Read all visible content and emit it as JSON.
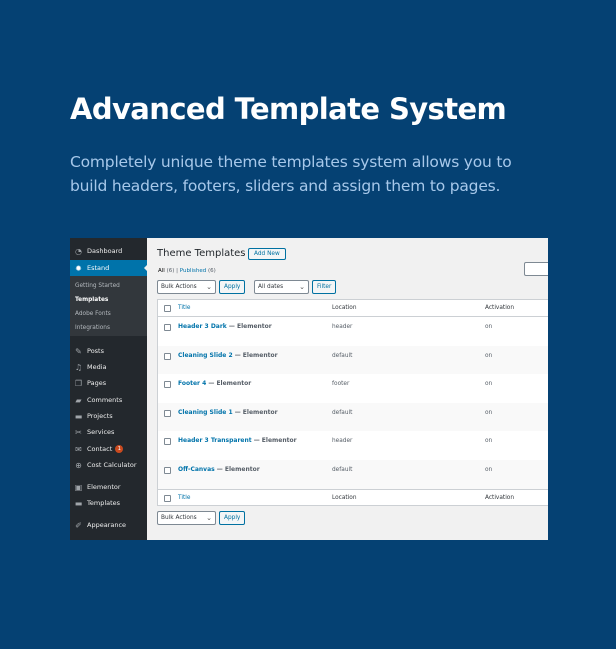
{
  "hero": {
    "title": "Advanced Template System",
    "subtitle": "Completely unique theme templates system allows you to build headers, footers, sliders and assign them to pages."
  },
  "sidebar": {
    "items": [
      {
        "label": "Dashboard",
        "icon": "dashboard-icon"
      },
      {
        "label": "Estand",
        "icon": "gear-icon",
        "active": true
      },
      {
        "label": "Posts",
        "icon": "pin-icon"
      },
      {
        "label": "Media",
        "icon": "media-icon"
      },
      {
        "label": "Pages",
        "icon": "pages-icon"
      },
      {
        "label": "Comments",
        "icon": "comment-icon"
      },
      {
        "label": "Projects",
        "icon": "folder-icon"
      },
      {
        "label": "Services",
        "icon": "tools-icon"
      },
      {
        "label": "Contact",
        "icon": "mail-icon",
        "badge": "1"
      },
      {
        "label": "Cost Calculator",
        "icon": "plus-circle-icon"
      },
      {
        "label": "Elementor",
        "icon": "elementor-icon"
      },
      {
        "label": "Templates",
        "icon": "folder-icon"
      },
      {
        "label": "Appearance",
        "icon": "brush-icon"
      }
    ],
    "submenu": [
      {
        "label": "Getting Started"
      },
      {
        "label": "Templates",
        "current": true
      },
      {
        "label": "Adobe Fonts"
      },
      {
        "label": "Integrations"
      }
    ]
  },
  "main": {
    "page_title": "Theme Templates",
    "add_new_label": "Add New",
    "views": {
      "all": "All",
      "all_count": "(6)",
      "separator": "|",
      "published": "Published",
      "published_count": "(6)"
    },
    "bulk_actions": "Bulk Actions",
    "apply_label": "Apply",
    "all_dates": "All dates",
    "filter_label": "Filter",
    "columns": {
      "title": "Title",
      "location": "Location",
      "activation": "Activation"
    },
    "rows": [
      {
        "name": "Header 3 Dark",
        "suffix": " — Elementor",
        "location": "header",
        "activation": "on"
      },
      {
        "name": "Cleaning Slide 2",
        "suffix": " — Elementor",
        "location": "default",
        "activation": "on"
      },
      {
        "name": "Footer 4",
        "suffix": " — Elementor",
        "location": "footer",
        "activation": "on"
      },
      {
        "name": "Cleaning Slide 1",
        "suffix": " — Elementor",
        "location": "default",
        "activation": "on"
      },
      {
        "name": "Header 3 Transparent",
        "suffix": " — Elementor",
        "location": "header",
        "activation": "on"
      },
      {
        "name": "Off-Canvas",
        "suffix": " — Elementor",
        "location": "default",
        "activation": "on"
      }
    ]
  },
  "colors": {
    "background": "#054173",
    "wp_blue": "#0073aa",
    "sidebar": "#23282d",
    "badge": "#ca4a1f"
  }
}
